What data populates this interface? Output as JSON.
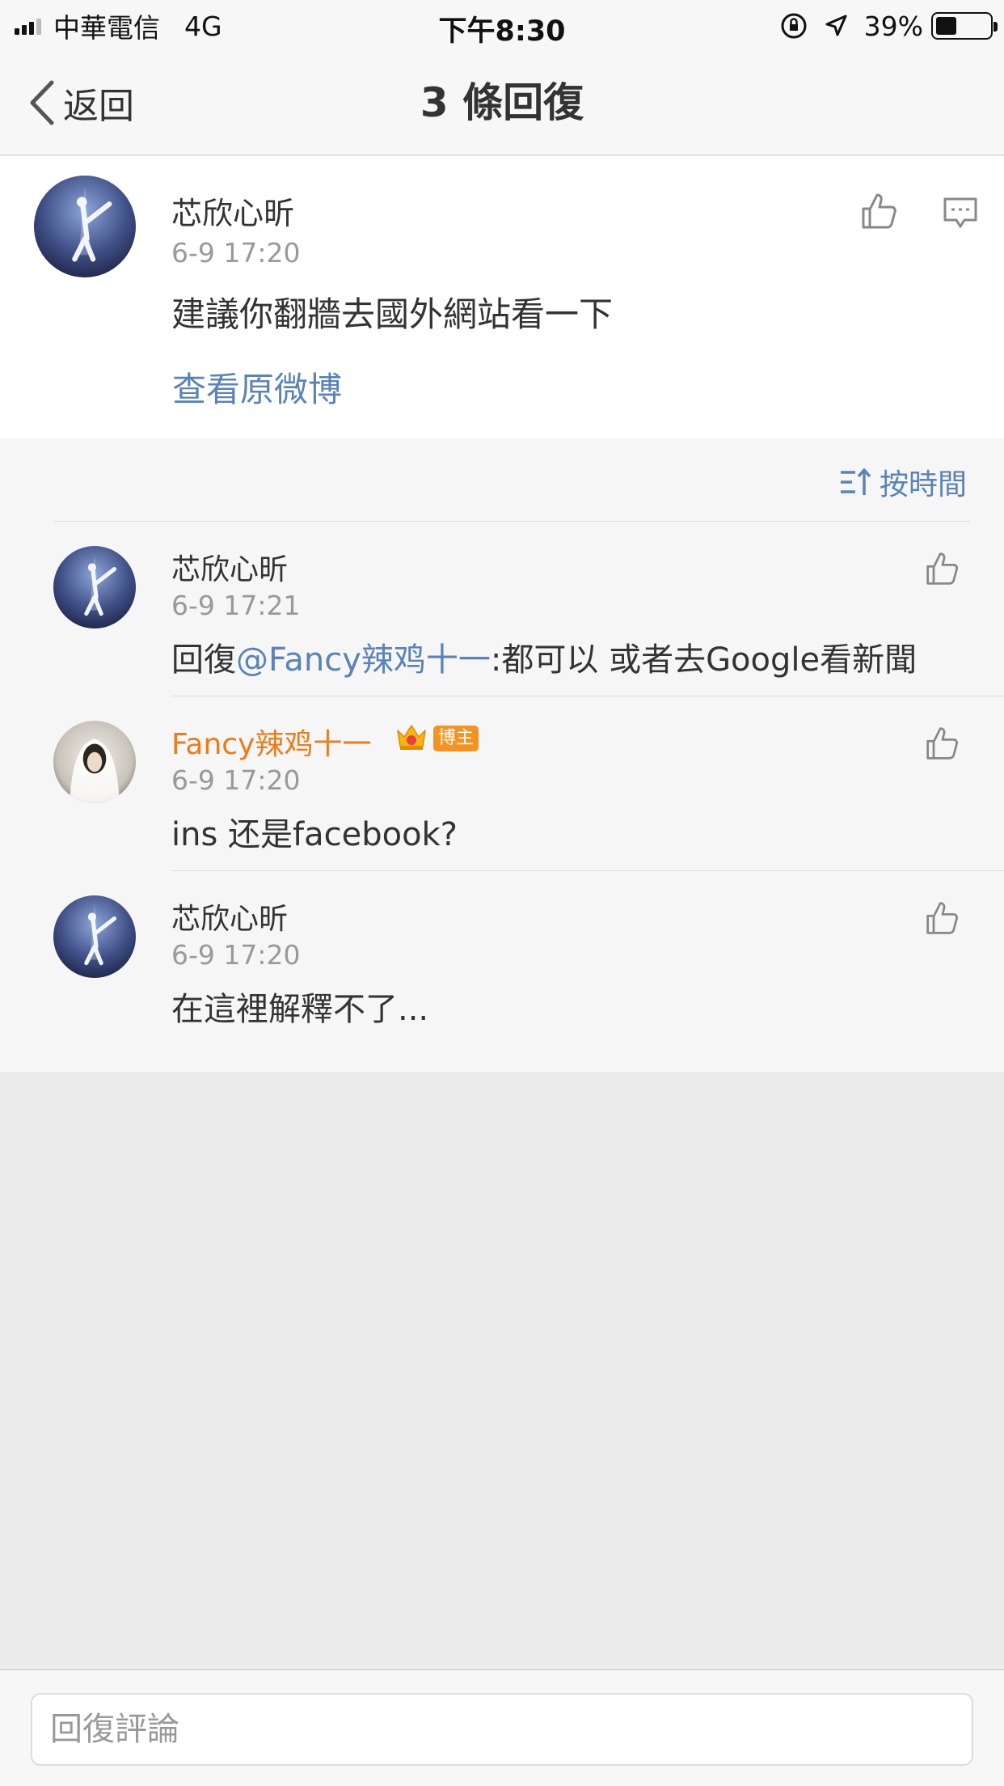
{
  "status_bar": {
    "carrier": "中華電信",
    "network": "4G",
    "time": "下午8:30",
    "battery": "39%",
    "battery_level": 0.39
  },
  "nav": {
    "back_label": "返回",
    "title": "3 條回復"
  },
  "main_comment": {
    "username": "芯欣心昕",
    "timestamp": "6-9 17:20",
    "text": "建議你翻牆去國外網站看一下",
    "view_original": "查看原微博"
  },
  "sort": {
    "label": "按時間"
  },
  "replies": [
    {
      "username": "芯欣心昕",
      "timestamp": "6-9 17:21",
      "prefix": "回復",
      "mention": "@Fancy辣鸡十一",
      "text": ":都可以 或者去Google看新聞"
    },
    {
      "username": "Fancy辣鸡十一",
      "timestamp": "6-9 17:20",
      "badge": "博主",
      "text": "ins 还是facebook?"
    },
    {
      "username": "芯欣心昕",
      "timestamp": "6-9 17:20",
      "text": "在這裡解釋不了..."
    }
  ],
  "input": {
    "placeholder": "回復評論"
  },
  "colors": {
    "link": "#5b83b7",
    "vip": "#eb7b1c",
    "badge": "#f39326"
  }
}
